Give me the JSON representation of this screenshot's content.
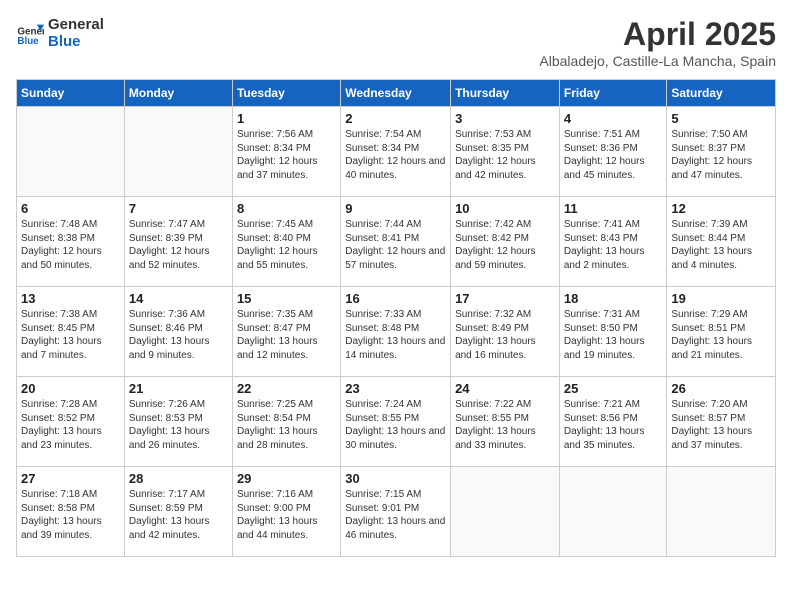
{
  "logo": {
    "general": "General",
    "blue": "Blue"
  },
  "title": "April 2025",
  "subtitle": "Albaladejo, Castille-La Mancha, Spain",
  "weekdays": [
    "Sunday",
    "Monday",
    "Tuesday",
    "Wednesday",
    "Thursday",
    "Friday",
    "Saturday"
  ],
  "weeks": [
    [
      {
        "day": "",
        "info": ""
      },
      {
        "day": "",
        "info": ""
      },
      {
        "day": "1",
        "info": "Sunrise: 7:56 AM\nSunset: 8:34 PM\nDaylight: 12 hours and 37 minutes."
      },
      {
        "day": "2",
        "info": "Sunrise: 7:54 AM\nSunset: 8:34 PM\nDaylight: 12 hours and 40 minutes."
      },
      {
        "day": "3",
        "info": "Sunrise: 7:53 AM\nSunset: 8:35 PM\nDaylight: 12 hours and 42 minutes."
      },
      {
        "day": "4",
        "info": "Sunrise: 7:51 AM\nSunset: 8:36 PM\nDaylight: 12 hours and 45 minutes."
      },
      {
        "day": "5",
        "info": "Sunrise: 7:50 AM\nSunset: 8:37 PM\nDaylight: 12 hours and 47 minutes."
      }
    ],
    [
      {
        "day": "6",
        "info": "Sunrise: 7:48 AM\nSunset: 8:38 PM\nDaylight: 12 hours and 50 minutes."
      },
      {
        "day": "7",
        "info": "Sunrise: 7:47 AM\nSunset: 8:39 PM\nDaylight: 12 hours and 52 minutes."
      },
      {
        "day": "8",
        "info": "Sunrise: 7:45 AM\nSunset: 8:40 PM\nDaylight: 12 hours and 55 minutes."
      },
      {
        "day": "9",
        "info": "Sunrise: 7:44 AM\nSunset: 8:41 PM\nDaylight: 12 hours and 57 minutes."
      },
      {
        "day": "10",
        "info": "Sunrise: 7:42 AM\nSunset: 8:42 PM\nDaylight: 12 hours and 59 minutes."
      },
      {
        "day": "11",
        "info": "Sunrise: 7:41 AM\nSunset: 8:43 PM\nDaylight: 13 hours and 2 minutes."
      },
      {
        "day": "12",
        "info": "Sunrise: 7:39 AM\nSunset: 8:44 PM\nDaylight: 13 hours and 4 minutes."
      }
    ],
    [
      {
        "day": "13",
        "info": "Sunrise: 7:38 AM\nSunset: 8:45 PM\nDaylight: 13 hours and 7 minutes."
      },
      {
        "day": "14",
        "info": "Sunrise: 7:36 AM\nSunset: 8:46 PM\nDaylight: 13 hours and 9 minutes."
      },
      {
        "day": "15",
        "info": "Sunrise: 7:35 AM\nSunset: 8:47 PM\nDaylight: 13 hours and 12 minutes."
      },
      {
        "day": "16",
        "info": "Sunrise: 7:33 AM\nSunset: 8:48 PM\nDaylight: 13 hours and 14 minutes."
      },
      {
        "day": "17",
        "info": "Sunrise: 7:32 AM\nSunset: 8:49 PM\nDaylight: 13 hours and 16 minutes."
      },
      {
        "day": "18",
        "info": "Sunrise: 7:31 AM\nSunset: 8:50 PM\nDaylight: 13 hours and 19 minutes."
      },
      {
        "day": "19",
        "info": "Sunrise: 7:29 AM\nSunset: 8:51 PM\nDaylight: 13 hours and 21 minutes."
      }
    ],
    [
      {
        "day": "20",
        "info": "Sunrise: 7:28 AM\nSunset: 8:52 PM\nDaylight: 13 hours and 23 minutes."
      },
      {
        "day": "21",
        "info": "Sunrise: 7:26 AM\nSunset: 8:53 PM\nDaylight: 13 hours and 26 minutes."
      },
      {
        "day": "22",
        "info": "Sunrise: 7:25 AM\nSunset: 8:54 PM\nDaylight: 13 hours and 28 minutes."
      },
      {
        "day": "23",
        "info": "Sunrise: 7:24 AM\nSunset: 8:55 PM\nDaylight: 13 hours and 30 minutes."
      },
      {
        "day": "24",
        "info": "Sunrise: 7:22 AM\nSunset: 8:55 PM\nDaylight: 13 hours and 33 minutes."
      },
      {
        "day": "25",
        "info": "Sunrise: 7:21 AM\nSunset: 8:56 PM\nDaylight: 13 hours and 35 minutes."
      },
      {
        "day": "26",
        "info": "Sunrise: 7:20 AM\nSunset: 8:57 PM\nDaylight: 13 hours and 37 minutes."
      }
    ],
    [
      {
        "day": "27",
        "info": "Sunrise: 7:18 AM\nSunset: 8:58 PM\nDaylight: 13 hours and 39 minutes."
      },
      {
        "day": "28",
        "info": "Sunrise: 7:17 AM\nSunset: 8:59 PM\nDaylight: 13 hours and 42 minutes."
      },
      {
        "day": "29",
        "info": "Sunrise: 7:16 AM\nSunset: 9:00 PM\nDaylight: 13 hours and 44 minutes."
      },
      {
        "day": "30",
        "info": "Sunrise: 7:15 AM\nSunset: 9:01 PM\nDaylight: 13 hours and 46 minutes."
      },
      {
        "day": "",
        "info": ""
      },
      {
        "day": "",
        "info": ""
      },
      {
        "day": "",
        "info": ""
      }
    ]
  ]
}
